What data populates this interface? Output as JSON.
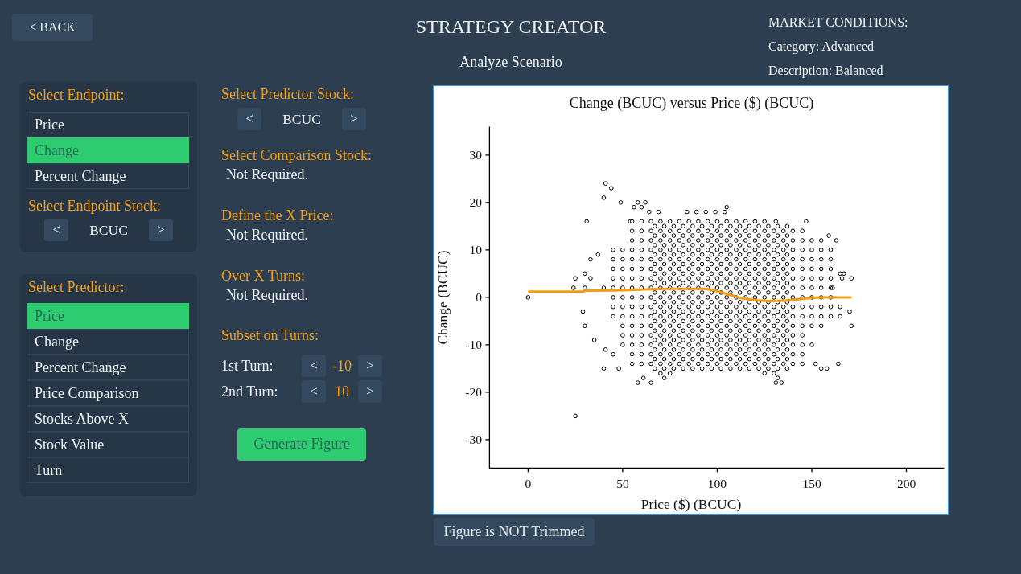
{
  "header": {
    "back_button": "< BACK",
    "title": "STRATEGY CREATOR",
    "subtitle": "Analyze Scenario"
  },
  "market_conditions": {
    "heading": "MARKET CONDITIONS:",
    "lines": [
      "Category: Advanced",
      "Description: Balanced"
    ]
  },
  "endpoint_panel": {
    "heading": "Select Endpoint:",
    "items": [
      {
        "label": "Price",
        "selected": false
      },
      {
        "label": "Change",
        "selected": true
      },
      {
        "label": "Percent Change",
        "selected": false
      }
    ],
    "stock_heading": "Select Endpoint Stock:",
    "stock_picker": {
      "prev": "<",
      "value": "BCUC",
      "next": ">"
    }
  },
  "predictor_panel": {
    "heading": "Select Predictor:",
    "items": [
      {
        "label": "Price",
        "selected": true
      },
      {
        "label": "Change",
        "selected": false
      },
      {
        "label": "Percent Change",
        "selected": false
      },
      {
        "label": "Price Comparison",
        "selected": false
      },
      {
        "label": "Stocks Above X",
        "selected": false
      },
      {
        "label": "Stock Value",
        "selected": false
      },
      {
        "label": "Turn",
        "selected": false
      }
    ]
  },
  "settings": {
    "predictor_stock_heading": "Select Predictor Stock:",
    "predictor_stock_picker": {
      "prev": "<",
      "value": "BCUC",
      "next": ">"
    },
    "sections": [
      {
        "heading": "Select Comparison Stock:",
        "value": "Not Required."
      },
      {
        "heading": "Define the X Price:",
        "value": "Not Required."
      },
      {
        "heading": "Over X Turns:",
        "value": "Not Required."
      }
    ],
    "subset_heading": "Subset on Turns:",
    "turns": [
      {
        "label": "1st Turn:",
        "prev": "<",
        "value": "-10",
        "next": ">"
      },
      {
        "label": "2nd Turn:",
        "prev": "<",
        "value": "10",
        "next": ">"
      }
    ],
    "generate_button": "Generate Figure"
  },
  "figure": {
    "chart_data": {
      "type": "scatter",
      "title": "Change (BCUC) versus Price ($) (BCUC)",
      "xlabel": "Price ($) (BCUC)",
      "ylabel": "Change (BCUC)",
      "xlim": [
        -20.4,
        220
      ],
      "ylim": [
        -36,
        36
      ],
      "xticks": [
        0,
        50,
        100,
        150,
        200
      ],
      "yticks": [
        -30,
        -20,
        -10,
        0,
        10,
        20,
        30
      ],
      "series": [
        {
          "type": "scatter",
          "color": "#000000",
          "x": [
            64,
            69,
            84,
            89,
            94,
            99,
            104,
            55,
            60,
            65,
            70,
            75,
            80,
            85,
            90,
            95,
            100,
            105,
            110,
            115,
            120,
            125,
            55,
            60,
            65,
            70,
            75,
            80,
            85,
            90,
            95,
            100,
            105,
            110,
            115,
            120,
            125,
            130,
            135,
            140,
            145,
            55,
            60,
            65,
            70,
            75,
            80,
            85,
            90,
            95,
            100,
            105,
            110,
            115,
            120,
            125,
            130,
            135,
            140,
            145,
            150,
            155,
            45,
            50,
            55,
            60,
            65,
            70,
            75,
            80,
            85,
            90,
            95,
            100,
            105,
            110,
            115,
            120,
            125,
            130,
            135,
            140,
            145,
            150,
            155,
            160,
            45,
            50,
            55,
            60,
            65,
            70,
            75,
            80,
            85,
            90,
            95,
            100,
            105,
            110,
            115,
            120,
            125,
            130,
            135,
            140,
            145,
            150,
            155,
            160,
            45,
            50,
            55,
            60,
            65,
            70,
            75,
            80,
            85,
            90,
            95,
            100,
            105,
            110,
            115,
            120,
            125,
            130,
            135,
            140,
            145,
            150,
            155,
            160,
            45,
            50,
            55,
            60,
            65,
            70,
            75,
            80,
            85,
            90,
            95,
            100,
            105,
            110,
            115,
            120,
            125,
            130,
            135,
            140,
            145,
            150,
            155,
            160,
            40,
            45,
            50,
            55,
            60,
            65,
            70,
            75,
            80,
            85,
            90,
            95,
            100,
            105,
            110,
            115,
            120,
            125,
            130,
            135,
            140,
            145,
            150,
            155,
            160,
            45,
            50,
            55,
            60,
            65,
            70,
            75,
            80,
            85,
            90,
            95,
            100,
            105,
            110,
            115,
            120,
            125,
            130,
            135,
            140,
            145,
            150,
            155,
            160,
            45,
            50,
            55,
            60,
            65,
            70,
            75,
            80,
            85,
            90,
            95,
            100,
            105,
            110,
            115,
            120,
            125,
            130,
            135,
            140,
            145,
            150,
            155,
            160,
            165,
            45,
            50,
            55,
            60,
            65,
            70,
            75,
            80,
            85,
            90,
            95,
            100,
            105,
            110,
            115,
            120,
            125,
            130,
            135,
            140,
            145,
            150,
            155,
            160,
            50,
            55,
            60,
            65,
            70,
            75,
            80,
            85,
            90,
            95,
            100,
            105,
            110,
            115,
            120,
            125,
            130,
            135,
            140,
            145,
            150,
            155,
            50,
            55,
            60,
            65,
            70,
            75,
            80,
            85,
            90,
            95,
            100,
            105,
            110,
            115,
            120,
            125,
            130,
            135,
            140,
            145,
            50,
            55,
            60,
            65,
            70,
            75,
            80,
            85,
            90,
            95,
            100,
            105,
            110,
            115,
            120,
            125,
            130,
            135,
            140,
            145,
            150,
            55,
            60,
            65,
            70,
            75,
            80,
            85,
            90,
            95,
            100,
            105,
            110,
            115,
            120,
            125,
            130,
            135,
            140,
            145,
            55,
            60,
            65,
            70,
            75,
            80,
            85,
            90,
            95,
            100,
            105,
            110,
            115,
            120,
            125,
            130,
            135,
            140,
            145,
            70,
            75,
            125,
            130,
            67,
            72,
            77,
            82,
            87,
            92,
            97,
            102,
            107,
            112,
            117,
            122,
            127,
            132,
            137,
            67,
            72,
            77,
            82,
            87,
            92,
            97,
            102,
            107,
            112,
            117,
            122,
            127,
            132,
            137,
            67,
            72,
            77,
            82,
            87,
            92,
            97,
            102,
            107,
            112,
            117,
            122,
            127,
            132,
            137,
            67,
            72,
            77,
            82,
            87,
            92,
            97,
            102,
            107,
            112,
            117,
            122,
            127,
            132,
            137,
            67,
            72,
            77,
            82,
            87,
            92,
            97,
            102,
            107,
            112,
            117,
            122,
            127,
            132,
            137,
            67,
            72,
            77,
            82,
            87,
            92,
            97,
            102,
            107,
            112,
            117,
            122,
            127,
            132,
            137,
            67,
            72,
            77,
            82,
            87,
            92,
            97,
            102,
            107,
            112,
            117,
            122,
            127,
            132,
            137,
            67,
            72,
            77,
            82,
            87,
            92,
            97,
            102,
            107,
            112,
            117,
            122,
            127,
            132,
            137,
            67,
            72,
            77,
            82,
            87,
            92,
            97,
            102,
            107,
            112,
            117,
            122,
            127,
            132,
            137,
            67,
            72,
            77,
            82,
            87,
            92,
            97,
            102,
            107,
            112,
            117,
            122,
            127,
            132,
            137,
            67,
            72,
            77,
            82,
            87,
            92,
            97,
            102,
            107,
            112,
            117,
            122,
            127,
            132,
            137,
            67,
            72,
            77,
            82,
            87,
            92,
            97,
            102,
            107,
            112,
            117,
            122,
            127,
            132,
            137,
            67,
            72,
            77,
            82,
            87,
            92,
            97,
            102,
            107,
            112,
            117,
            122,
            127,
            132,
            137,
            67,
            72,
            77,
            82,
            87,
            92,
            97,
            102,
            107,
            112,
            117,
            122,
            127,
            132,
            137,
            67,
            72,
            77,
            82,
            87,
            92,
            97,
            102,
            107,
            112,
            117,
            122,
            127,
            132,
            137,
            67,
            72,
            77,
            82,
            87,
            92,
            97,
            102,
            107,
            112,
            117,
            122,
            127,
            132,
            137,
            0,
            25,
            24,
            30,
            25,
            30,
            33,
            31,
            37,
            33,
            40,
            41,
            44,
            49,
            54,
            56,
            58,
            62,
            60,
            105,
            131,
            147,
            163,
            166,
            171,
            165,
            167,
            161,
            159,
            29,
            30,
            35,
            40,
            48,
            41,
            45,
            58,
            65,
            61,
            131,
            134,
            171,
            165,
            170,
            158,
            164,
            155,
            152,
            72,
            132
          ],
          "values": [
            18,
            18,
            18,
            18,
            18,
            18,
            18,
            16,
            16,
            16,
            16,
            16,
            16,
            16,
            16,
            16,
            16,
            16,
            16,
            16,
            16,
            16,
            14,
            14,
            14,
            14,
            14,
            14,
            14,
            14,
            14,
            14,
            14,
            14,
            14,
            14,
            14,
            14,
            14,
            14,
            14,
            12,
            12,
            12,
            12,
            12,
            12,
            12,
            12,
            12,
            12,
            12,
            12,
            12,
            12,
            12,
            12,
            12,
            12,
            12,
            12,
            12,
            10,
            10,
            10,
            10,
            10,
            10,
            10,
            10,
            10,
            10,
            10,
            10,
            10,
            10,
            10,
            10,
            10,
            10,
            10,
            10,
            10,
            10,
            10,
            10,
            8,
            8,
            8,
            8,
            8,
            8,
            8,
            8,
            8,
            8,
            8,
            8,
            8,
            8,
            8,
            8,
            8,
            8,
            8,
            8,
            8,
            8,
            8,
            8,
            6,
            6,
            6,
            6,
            6,
            6,
            6,
            6,
            6,
            6,
            6,
            6,
            6,
            6,
            6,
            6,
            6,
            6,
            6,
            6,
            6,
            6,
            6,
            6,
            4,
            4,
            4,
            4,
            4,
            4,
            4,
            4,
            4,
            4,
            4,
            4,
            4,
            4,
            4,
            4,
            4,
            4,
            4,
            4,
            4,
            4,
            4,
            4,
            2,
            2,
            2,
            2,
            2,
            2,
            2,
            2,
            2,
            2,
            2,
            2,
            2,
            2,
            2,
            2,
            2,
            2,
            2,
            2,
            2,
            2,
            2,
            2,
            2,
            0,
            0,
            0,
            0,
            0,
            0,
            0,
            0,
            0,
            0,
            0,
            0,
            0,
            0,
            0,
            0,
            0,
            0,
            0,
            0,
            0,
            0,
            0,
            0,
            -2,
            -2,
            -2,
            -2,
            -2,
            -2,
            -2,
            -2,
            -2,
            -2,
            -2,
            -2,
            -2,
            -2,
            -2,
            -2,
            -2,
            -2,
            -2,
            -2,
            -2,
            -2,
            -2,
            -2,
            -2,
            -4,
            -4,
            -4,
            -4,
            -4,
            -4,
            -4,
            -4,
            -4,
            -4,
            -4,
            -4,
            -4,
            -4,
            -4,
            -4,
            -4,
            -4,
            -4,
            -4,
            -4,
            -4,
            -4,
            -4,
            -6,
            -6,
            -6,
            -6,
            -6,
            -6,
            -6,
            -6,
            -6,
            -6,
            -6,
            -6,
            -6,
            -6,
            -6,
            -6,
            -6,
            -6,
            -6,
            -6,
            -6,
            -6,
            -8,
            -8,
            -8,
            -8,
            -8,
            -8,
            -8,
            -8,
            -8,
            -8,
            -8,
            -8,
            -8,
            -8,
            -8,
            -8,
            -8,
            -8,
            -8,
            -8,
            -10,
            -10,
            -10,
            -10,
            -10,
            -10,
            -10,
            -10,
            -10,
            -10,
            -10,
            -10,
            -10,
            -10,
            -10,
            -10,
            -10,
            -10,
            -10,
            -10,
            -10,
            -12,
            -12,
            -12,
            -12,
            -12,
            -12,
            -12,
            -12,
            -12,
            -12,
            -12,
            -12,
            -12,
            -12,
            -12,
            -12,
            -12,
            -12,
            -12,
            -14,
            -14,
            -14,
            -14,
            -14,
            -14,
            -14,
            -14,
            -14,
            -14,
            -14,
            -14,
            -14,
            -14,
            -14,
            -14,
            -14,
            -14,
            -14,
            -16,
            -16,
            -16,
            -16,
            15,
            15,
            15,
            15,
            15,
            15,
            15,
            15,
            15,
            15,
            15,
            15,
            15,
            15,
            15,
            13,
            13,
            13,
            13,
            13,
            13,
            13,
            13,
            13,
            13,
            13,
            13,
            13,
            13,
            13,
            11,
            11,
            11,
            11,
            11,
            11,
            11,
            11,
            11,
            11,
            11,
            11,
            11,
            11,
            11,
            9,
            9,
            9,
            9,
            9,
            9,
            9,
            9,
            9,
            9,
            9,
            9,
            9,
            9,
            9,
            7,
            7,
            7,
            7,
            7,
            7,
            7,
            7,
            7,
            7,
            7,
            7,
            7,
            7,
            7,
            5,
            5,
            5,
            5,
            5,
            5,
            5,
            5,
            5,
            5,
            5,
            5,
            5,
            5,
            5,
            3,
            3,
            3,
            3,
            3,
            3,
            3,
            3,
            3,
            3,
            3,
            3,
            3,
            3,
            3,
            1,
            1,
            1,
            1,
            1,
            1,
            1,
            1,
            1,
            1,
            1,
            1,
            1,
            1,
            1,
            -1,
            -1,
            -1,
            -1,
            -1,
            -1,
            -1,
            -1,
            -1,
            -1,
            -1,
            -1,
            -1,
            -1,
            -1,
            -3,
            -3,
            -3,
            -3,
            -3,
            -3,
            -3,
            -3,
            -3,
            -3,
            -3,
            -3,
            -3,
            -3,
            -3,
            -5,
            -5,
            -5,
            -5,
            -5,
            -5,
            -5,
            -5,
            -5,
            -5,
            -5,
            -5,
            -5,
            -5,
            -5,
            -7,
            -7,
            -7,
            -7,
            -7,
            -7,
            -7,
            -7,
            -7,
            -7,
            -7,
            -7,
            -7,
            -7,
            -7,
            -9,
            -9,
            -9,
            -9,
            -9,
            -9,
            -9,
            -9,
            -9,
            -9,
            -9,
            -9,
            -9,
            -9,
            -9,
            -11,
            -11,
            -11,
            -11,
            -11,
            -11,
            -11,
            -11,
            -11,
            -11,
            -11,
            -11,
            -11,
            -11,
            -11,
            -13,
            -13,
            -13,
            -13,
            -13,
            -13,
            -13,
            -13,
            -13,
            -13,
            -13,
            -13,
            -13,
            -13,
            -13,
            -15,
            -15,
            -15,
            -15,
            -15,
            -15,
            -15,
            -15,
            -15,
            -15,
            -15,
            -15,
            -15,
            -15,
            -15,
            0,
            -25,
            2,
            2,
            4,
            5,
            4,
            16,
            9,
            8,
            21,
            24,
            23,
            20,
            16,
            19,
            20,
            20,
            19,
            19,
            16,
            16,
            12,
            4,
            4,
            5,
            5,
            2,
            13,
            -3,
            -6,
            -9,
            -15,
            -15,
            -11,
            -12,
            -18,
            -18,
            -17,
            -18,
            -18,
            -6,
            -4,
            -3,
            -15,
            -14,
            -15,
            -14,
            -17,
            -17
          ]
        },
        {
          "type": "line",
          "color": "#f39c12",
          "x": [
            0,
            29,
            30,
            50,
            70,
            94,
            99,
            106,
            113,
            120,
            128,
            136,
            143,
            150,
            157,
            171
          ],
          "values": [
            1.2,
            1.2,
            1.4,
            1.5,
            1.8,
            1.8,
            1.4,
            0.6,
            -0.2,
            -0.6,
            -0.8,
            -0.7,
            -0.4,
            -0.1,
            0,
            0
          ]
        }
      ]
    },
    "trim_button": "Figure is NOT Trimmed"
  }
}
